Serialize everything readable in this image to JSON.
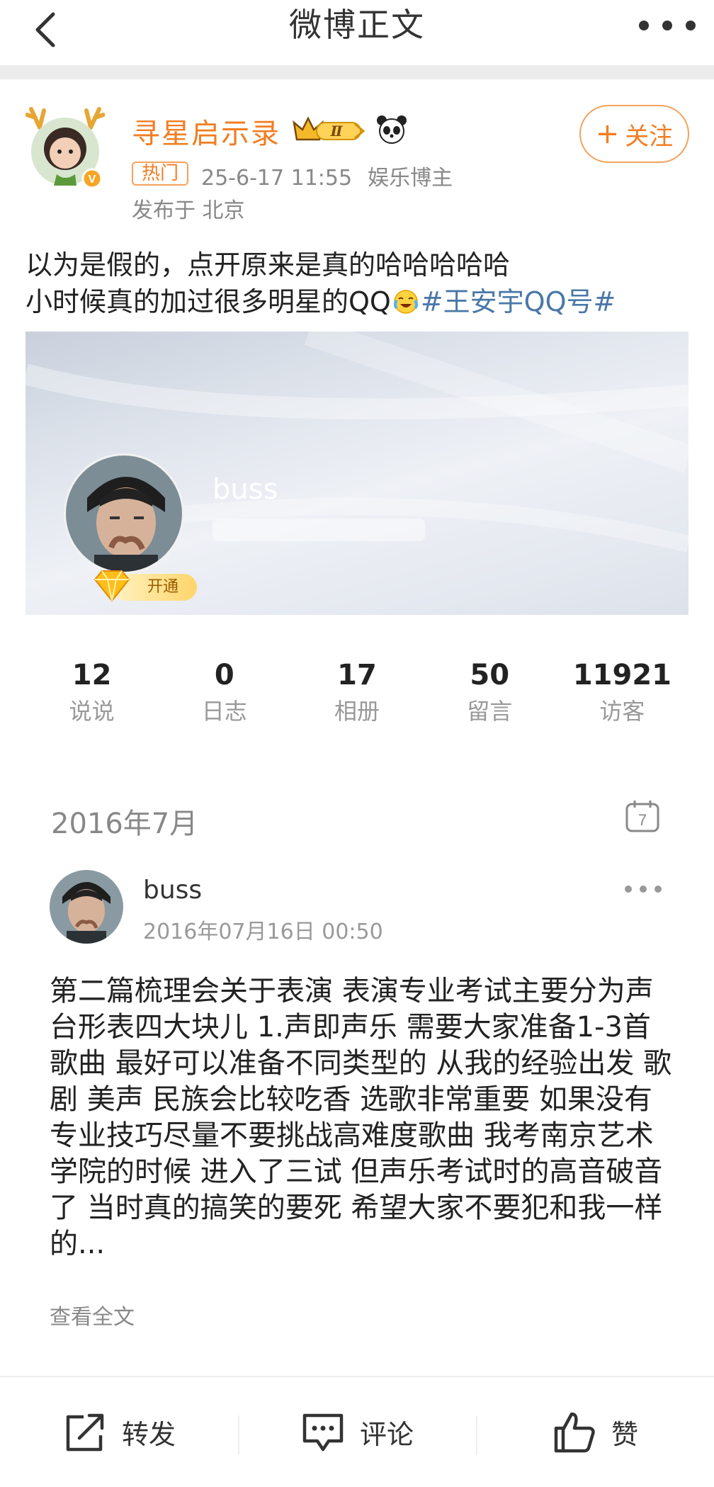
{
  "nav": {
    "title": "微博正文",
    "back_icon": "chevron-left-icon",
    "more_icon": "more-dots-icon"
  },
  "author": {
    "name": "寻星启示录",
    "level_badge": "Ⅱ",
    "hot_tag": "热门",
    "date": "25-6-17 11:55",
    "category": "娱乐博主",
    "location": "发布于 北京",
    "follow_label": "关注",
    "name_color": "#f27d22"
  },
  "post": {
    "line1": "以为是假的，点开原来是真的哈哈哈哈哈",
    "line2_text": "小时候真的加过很多明星的QQ",
    "hashtag": "#王安宇QQ号#",
    "hashtag_color": "#4a78a8"
  },
  "qq_profile": {
    "nickname": "buss",
    "vip_label": "开通",
    "stats": [
      {
        "num": "12",
        "label": "说说"
      },
      {
        "num": "0",
        "label": "日志"
      },
      {
        "num": "17",
        "label": "相册"
      },
      {
        "num": "50",
        "label": "留言"
      },
      {
        "num": "11921",
        "label": "访客"
      }
    ]
  },
  "feed": {
    "month": "2016年7月",
    "calendar_day": "7",
    "user": "buss",
    "time": "2016年07月16日 00:50",
    "body": "第二篇梳理会关于表演 表演专业考试主要分为声台形表四大块儿 1.声即声乐 需要大家准备1-3首歌曲 最好可以准备不同类型的 从我的经验出发 歌剧 美声 民族会比较吃香 选歌非常重要 如果没有专业技巧尽量不要挑战高难度歌曲 我考南京艺术学院的时候 进入了三试 但声乐考试时的高音破音了 当时真的搞笑的要死 希望大家不要犯和我一样的...",
    "read_more": "查看全文"
  },
  "actions": {
    "repost": "转发",
    "comment": "评论",
    "like": "赞"
  }
}
